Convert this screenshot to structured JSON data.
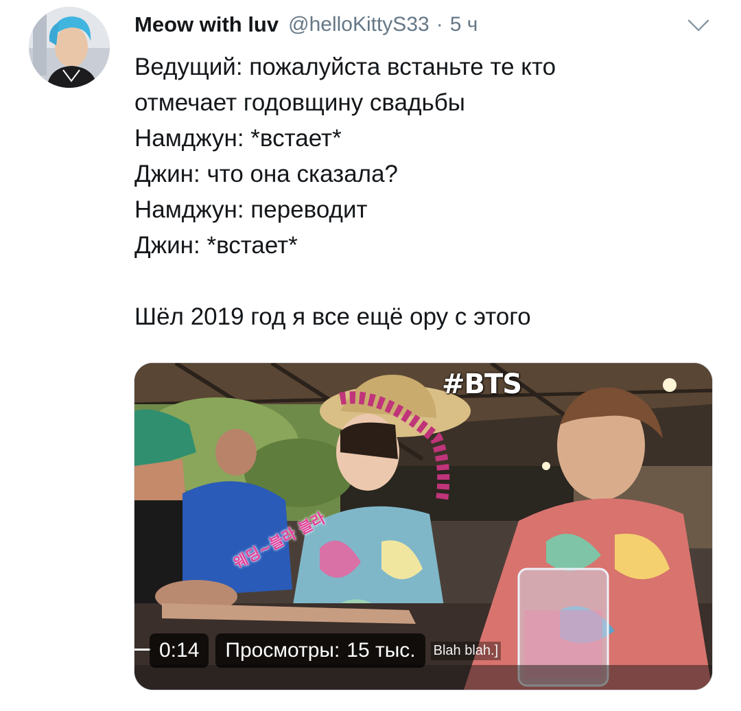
{
  "tweet": {
    "author": {
      "display_name": "Meow with luv",
      "handle": "@helloKittyS33",
      "separator": "·",
      "time": "5 ч"
    },
    "menu_icon": "chevron-down-icon",
    "lines": [
      "Ведущий: пожалуйста встаньте те кто",
      "отмечает годовщину свадьбы",
      "Намджун: *встает*",
      "Джин: что она сказала?",
      "Намджун: переводит",
      "Джин: *встает*"
    ],
    "last_line": "Шёл 2019 год я все ещё ору с этого"
  },
  "media": {
    "hashtag": "#BTS",
    "korean_caption": "웨딩~블라 블라",
    "duration": "0:14",
    "views_label": "Просмотры:",
    "views_value": "15 тыс.",
    "subtitle_fragment": "Blah blah.]"
  },
  "colors": {
    "text": "#14171a",
    "muted": "#657786",
    "caption_pink": "#e2409a"
  }
}
